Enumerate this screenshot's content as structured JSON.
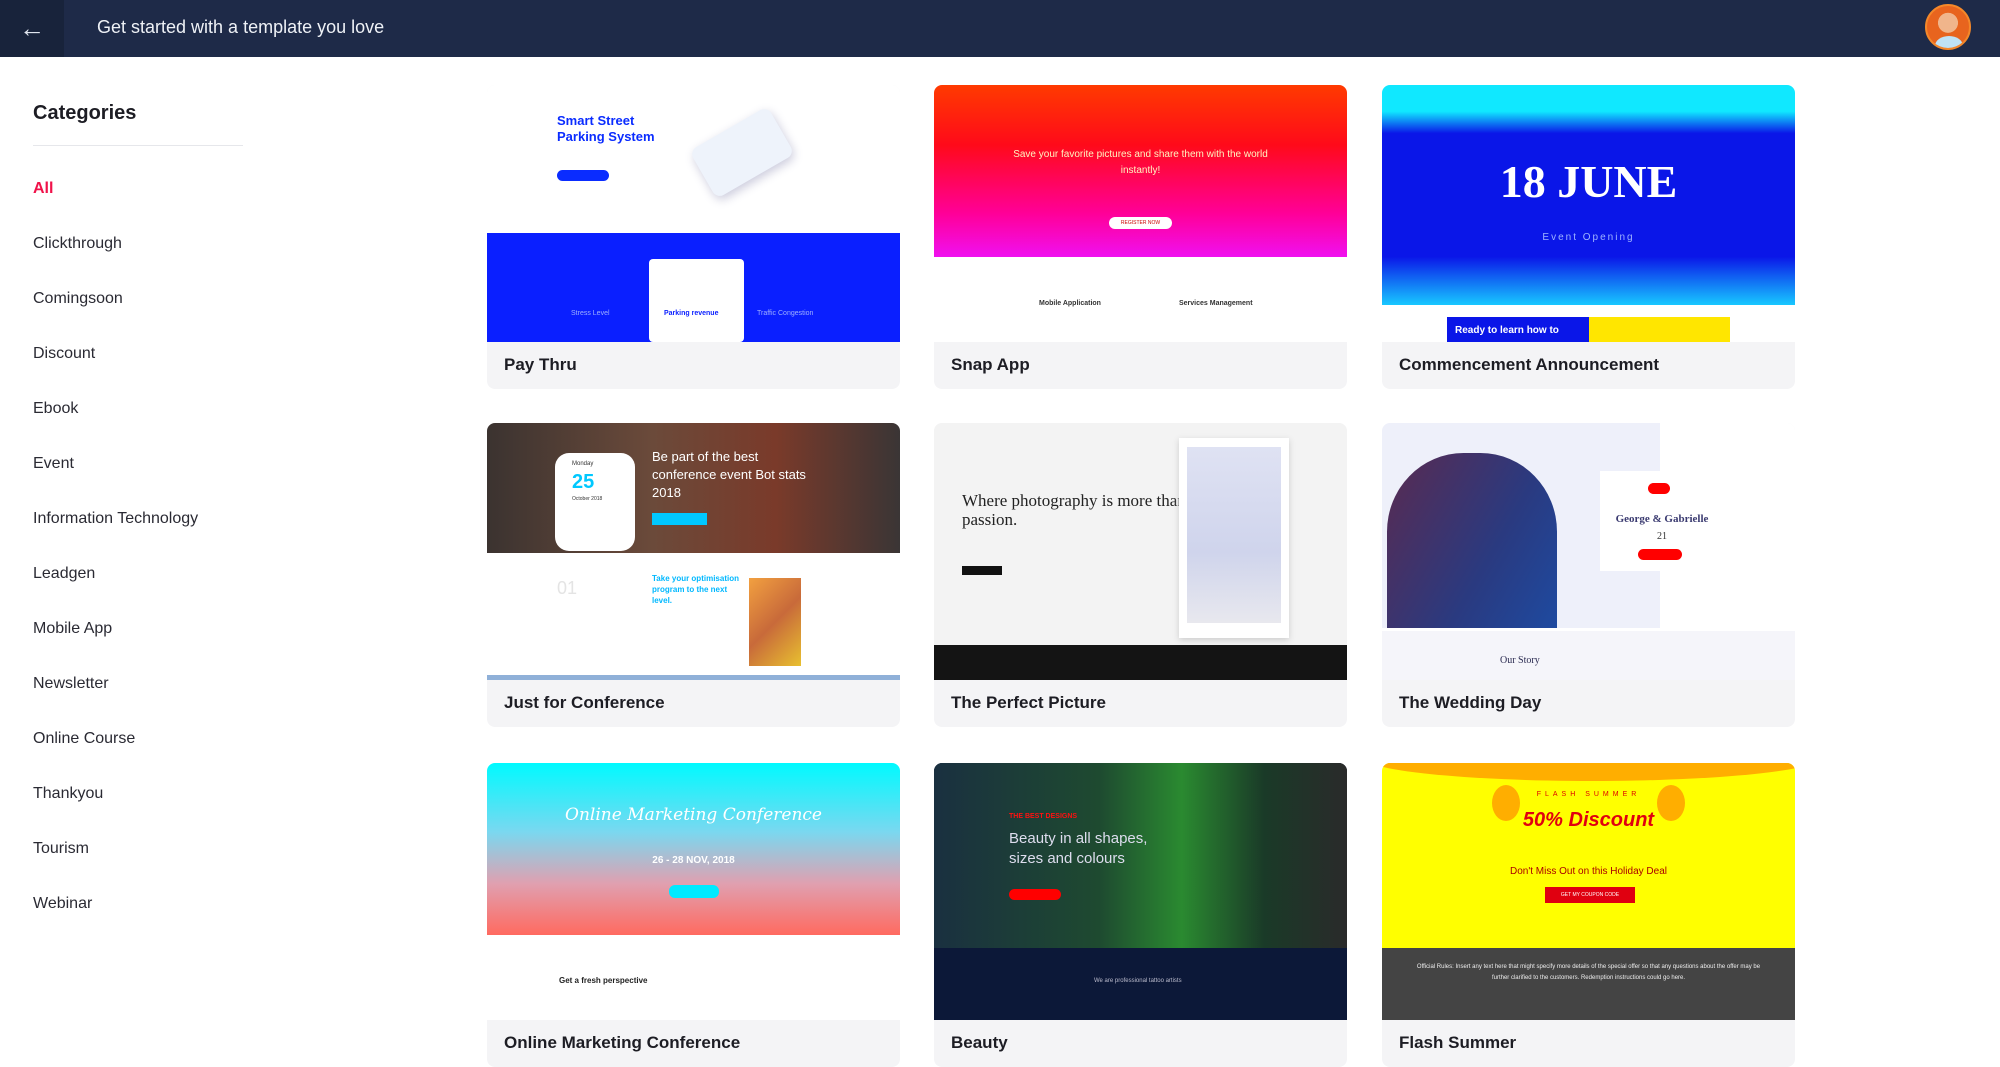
{
  "header": {
    "title": "Get started with a template you love",
    "back_icon": "arrow-left-icon",
    "avatar": "user-avatar"
  },
  "sidebar": {
    "title": "Categories",
    "active": "All",
    "items": [
      {
        "label": "All"
      },
      {
        "label": "Clickthrough"
      },
      {
        "label": "Comingsoon"
      },
      {
        "label": "Discount"
      },
      {
        "label": "Ebook"
      },
      {
        "label": "Event"
      },
      {
        "label": "Information Technology"
      },
      {
        "label": "Leadgen"
      },
      {
        "label": "Mobile App"
      },
      {
        "label": "Newsletter"
      },
      {
        "label": "Online Course"
      },
      {
        "label": "Thankyou"
      },
      {
        "label": "Tourism"
      },
      {
        "label": "Webinar"
      }
    ]
  },
  "colors": {
    "header_bg": "#1e2a48",
    "active_category": "#f0124a",
    "card_footer": "#f4f4f6"
  },
  "templates": [
    {
      "name": "Pay Thru",
      "preview": {
        "heading": "Smart Street Parking System",
        "items": [
          "Stress Level",
          "Parking revenue",
          "Traffic Congestion"
        ]
      }
    },
    {
      "name": "Snap App",
      "preview": {
        "heading": "Save your favorite pictures and share them with the world instantly!",
        "button": "REGISTER NOW",
        "items": [
          "Mobile Application",
          "Services Management"
        ]
      }
    },
    {
      "name": "Commencement Announcement",
      "preview": {
        "heading": "18 JUNE",
        "sub": "Event Opening",
        "banner": "Ready to learn how to"
      }
    },
    {
      "name": "Just for Conference",
      "preview": {
        "day": "Monday",
        "date": "25",
        "month": "October 2018",
        "heading": "Be part of the best conference event Bot stats 2018",
        "num": "01",
        "sub": "Take your optimisation program to the next level."
      }
    },
    {
      "name": "The Perfect Picture",
      "preview": {
        "heading": "Where photography is more than just passion."
      }
    },
    {
      "name": "The Wedding Day",
      "preview": {
        "heading": "George & Gabrielle",
        "date": "21",
        "sub": "Our Story"
      }
    },
    {
      "name": "Online Marketing Conference",
      "preview": {
        "heading": "Online Marketing Conference",
        "date": "26 - 28 NOV, 2018",
        "sub": "Get a fresh perspective"
      }
    },
    {
      "name": "Beauty",
      "preview": {
        "tag": "THE BEST DESIGNS",
        "heading": "Beauty in all shapes, sizes and colours",
        "sub": "We are professional tattoo artists"
      }
    },
    {
      "name": "Flash Summer",
      "preview": {
        "tag": "FLASH SUMMER",
        "heading": "50% Discount",
        "sub": "Don't Miss Out on this Holiday Deal",
        "button": "GET MY COUPON CODE",
        "rules": "Official Rules: Insert any text here that might specify more details of the special offer so that any questions about the offer may be further clarified to the customers. Redemption instructions could go here."
      }
    }
  ]
}
